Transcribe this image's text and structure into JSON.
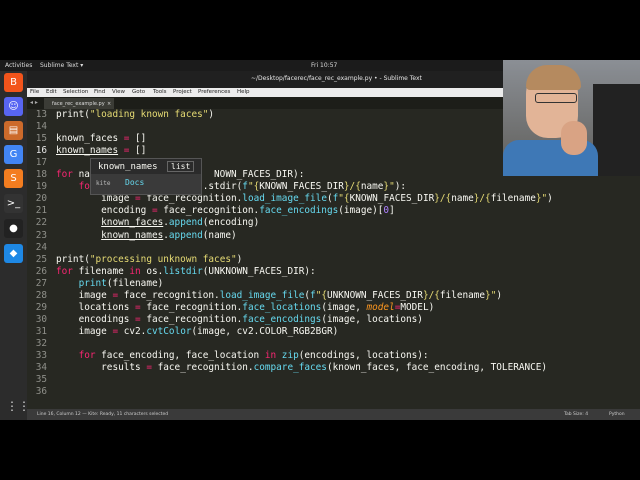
{
  "topbar": {
    "activities": "Activities",
    "app_menu": "Sublime Text ▾",
    "clock": "Fri 10:57"
  },
  "dock": {
    "items": [
      {
        "name": "brave-browser-icon",
        "glyph": "B",
        "color": "#f2541b"
      },
      {
        "name": "discord-icon",
        "glyph": "☺",
        "color": "#5865f2"
      },
      {
        "name": "files-icon",
        "glyph": "▤",
        "color": "#cc6a2b"
      },
      {
        "name": "chrome-icon",
        "glyph": "G",
        "color": "#4285f4"
      },
      {
        "name": "sublime-text-icon",
        "glyph": "S",
        "color": "#f37d20"
      },
      {
        "name": "terminal-icon",
        "glyph": ">_",
        "color": "#333333"
      },
      {
        "name": "obs-icon",
        "glyph": "●",
        "color": "#222222"
      },
      {
        "name": "kite-icon",
        "glyph": "◆",
        "color": "#1e88e5"
      }
    ],
    "grid_glyph": "⋮⋮⋮"
  },
  "window": {
    "title": "~/Desktop/facerec/face_rec_example.py • - Sublime Text"
  },
  "menu": [
    "File",
    "Edit",
    "Selection",
    "Find",
    "View",
    "Goto",
    "Tools",
    "Project",
    "Preferences",
    "Help"
  ],
  "tab": {
    "nav_arrows": "◂ ▸",
    "label": "face_rec_example.py",
    "close": "×"
  },
  "editor": {
    "current_line": 16,
    "lines": [
      {
        "n": 13,
        "html": "print(<span class='s'>\"loading known faces\"</span>)"
      },
      {
        "n": 14,
        "html": ""
      },
      {
        "n": 15,
        "html": "known_faces <span class='k'>=</span> []"
      },
      {
        "n": 16,
        "html": "<span class='hl'>known_names</span> <span class='k'>=</span> []"
      },
      {
        "n": 17,
        "html": ""
      },
      {
        "n": 18,
        "html": "<span class='k'>for</span> na                      NOWN_FACES_DIR):"
      },
      {
        "n": 19,
        "html": "    <span class='k'>fo</span>                    .stdir(<span class='f'>f</span><span class='s'>\"{</span>KNOWN_FACES_DIR<span class='s'>}/{</span>name<span class='s'>}\"</span>):"
      },
      {
        "n": 20,
        "html": "        image <span class='k'>=</span> face_recognition.<span class='f'>load_image_file</span>(<span class='f'>f</span><span class='s'>\"{</span>KNOWN_FACES_DIR<span class='s'>}/{</span>name<span class='s'>}/{</span>filename<span class='s'>}\"</span>)"
      },
      {
        "n": 21,
        "html": "        encoding <span class='k'>=</span> face_recognition.<span class='f'>face_encodings</span>(image)[<span class='n'>0</span>]"
      },
      {
        "n": 22,
        "html": "        <span class='hl'>known_faces</span>.<span class='f'>append</span>(encoding)"
      },
      {
        "n": 23,
        "html": "        <span class='hl'>known_names</span>.<span class='f'>append</span>(name)"
      },
      {
        "n": 24,
        "html": ""
      },
      {
        "n": 25,
        "html": "print(<span class='s'>\"processing unknown faces\"</span>)"
      },
      {
        "n": 26,
        "html": "<span class='k'>for</span> filename <span class='k'>in</span> os.<span class='f'>listdir</span>(UNKNOWN_FACES_DIR):"
      },
      {
        "n": 27,
        "html": "    <span class='f'>print</span>(filename)"
      },
      {
        "n": 28,
        "html": "    image <span class='k'>=</span> face_recognition.<span class='f'>load_image_file</span>(<span class='f'>f</span><span class='s'>\"{</span>UNKNOWN_FACES_DIR<span class='s'>}/{</span>filename<span class='s'>}\"</span>)"
      },
      {
        "n": 29,
        "html": "    locations <span class='k'>=</span> face_recognition.<span class='f'>face_locations</span>(image, <span class='i'>model</span><span class='k'>=</span>MODEL)"
      },
      {
        "n": 30,
        "html": "    encodings <span class='k'>=</span> face_recognition.<span class='f'>face_encodings</span>(image, locations)"
      },
      {
        "n": 31,
        "html": "    image <span class='k'>=</span> cv2.<span class='f'>cvtColor</span>(image, cv2.COLOR_RGB2BGR)"
      },
      {
        "n": 32,
        "html": ""
      },
      {
        "n": 33,
        "html": "    <span class='k'>for</span> face_encoding, face_location <span class='k'>in</span> <span class='f'>zip</span>(encodings, locations):"
      },
      {
        "n": 34,
        "html": "        results <span class='k'>=</span> face_recognition.<span class='f'>compare_faces</span>(known_faces, face_encoding, TOLERANCE)"
      },
      {
        "n": 35,
        "html": ""
      },
      {
        "n": 36,
        "html": ""
      }
    ]
  },
  "autocomplete": {
    "item": "known_names",
    "kind": "list",
    "source": "kite",
    "docs_link": "Docs"
  },
  "status": {
    "left": "Line 16, Column 12 — Kite: Ready, 11 characters selected",
    "tab_size": "Tab Size: 4",
    "syntax": "Python"
  }
}
